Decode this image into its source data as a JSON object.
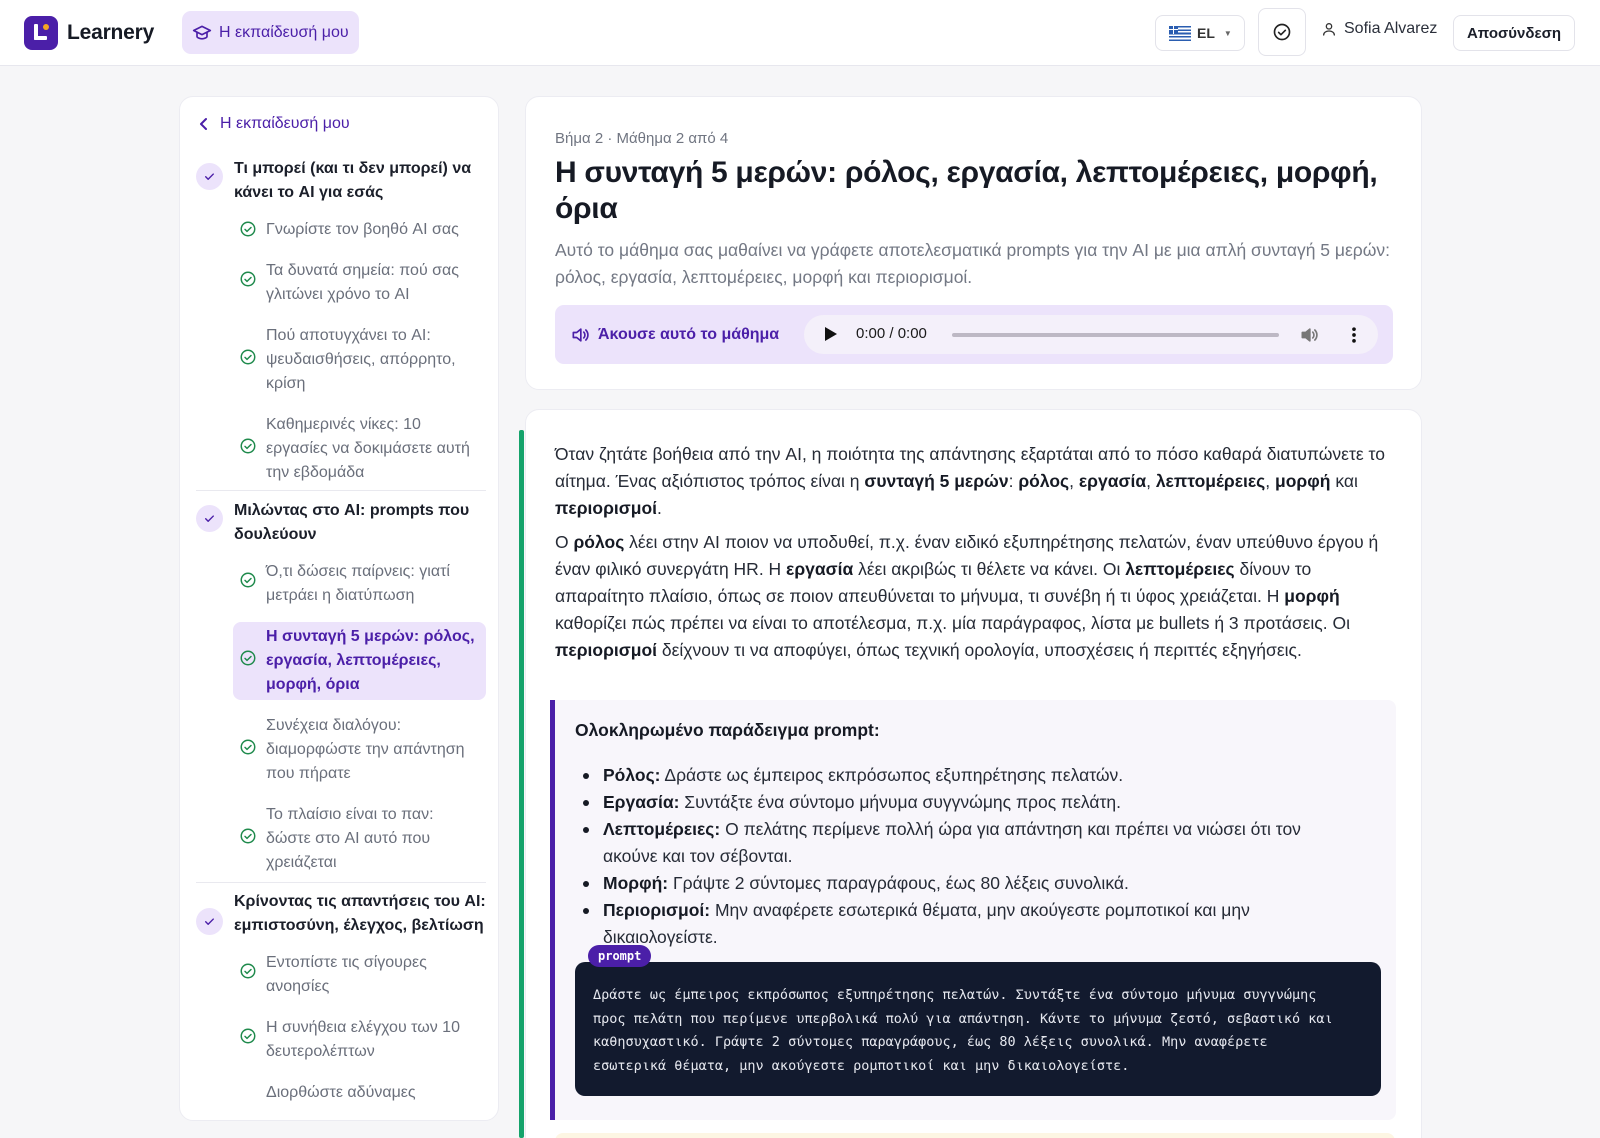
{
  "app": {
    "name": "Learnery"
  },
  "header": {
    "nav_label": "Η εκπαίδευσή μου",
    "language": "EL",
    "user_name": "Sofia Alvarez",
    "logout_label": "Αποσύνδεση"
  },
  "sidebar": {
    "back_label": "Η εκπαίδευσή μου",
    "modules": [
      {
        "title": "Τι μπορεί (και τι δεν μπορεί) να κάνει το AI για εσάς",
        "lessons": [
          "Γνωρίστε τον βοηθό AI σας",
          "Τα δυνατά σημεία: πού σας γλιτώνει χρόνο το AI",
          "Πού αποτυγχάνει το AI: ψευδαισθήσεις, απόρρητο, κρίση",
          "Καθημερινές νίκες: 10 εργασίες να δοκιμάσετε αυτή την εβδομάδα"
        ]
      },
      {
        "title": "Μιλώντας στο AI: prompts που δουλεύουν",
        "lessons": [
          "Ό,τι δώσεις παίρνεις: γιατί μετράει η διατύπωση",
          "Η συνταγή 5 μερών: ρόλος, εργασία, λεπτομέρειες, μορφή, όρια",
          "Συνέχεια διαλόγου: διαμορφώστε την απάντηση που πήρατε",
          "Το πλαίσιο είναι το παν: δώστε στο AI αυτό που χρειάζεται"
        ]
      },
      {
        "title": "Κρίνοντας τις απαντήσεις του AI: εμπιστοσύνη, έλεγχος, βελτίωση",
        "lessons": [
          "Εντοπίστε τις σίγουρες ανοησίες",
          "Η συνήθεια ελέγχου των 10 δευτερολέπτων",
          "Διορθώστε αδύναμες"
        ]
      }
    ]
  },
  "lesson": {
    "breadcrumb": "Βήμα 2 · Μάθημα 2 από 4",
    "title": "Η συνταγή 5 μερών: ρόλος, εργασία, λεπτομέρειες, μορφή, όρια",
    "description": "Αυτό το μάθημα σας μαθαίνει να γράφετε αποτελεσματικά prompts για την AI με μια απλή συνταγή 5 μερών: ρόλος, εργασία, λεπτομέρειες, μορφή και περιορισμοί.",
    "audio_label": "Άκουσε αυτό το μάθημα",
    "audio_time": "0:00 / 0:00",
    "audio_progress": 0
  },
  "body": {
    "p1": {
      "t1": "Όταν ζητάτε βοήθεια από την AI, η ποιότητα της απάντησης εξαρτάται από το πόσο καθαρά διατυπώνετε το αίτημα. Ένας αξιόπιστος τρόπος είναι η ",
      "b1": "συνταγή 5 μερών",
      "t2": ": ",
      "b2": "ρόλος",
      "t3": ", ",
      "b3": "εργασία",
      "t4": ", ",
      "b4": "λεπτομέρειες",
      "t5": ", ",
      "b5": "μορφή",
      "t6": " και ",
      "b6": "περιορισμοί",
      "t7": "."
    },
    "p2": {
      "t1": "Ο ",
      "b1": "ρόλος",
      "t2": " λέει στην AI ποιον να υποδυθεί, π.χ. έναν ειδικό εξυπηρέτησης πελατών, έναν υπεύθυνο έργου ή έναν φιλικό συνεργάτη HR. Η ",
      "b2": "εργασία",
      "t3": " λέει ακριβώς τι θέλετε να κάνει. Οι ",
      "b3": "λεπτομέρειες",
      "t4": " δίνουν το απαραίτητο πλαίσιο, όπως σε ποιον απευθύνεται το μήνυμα, τι συνέβη ή τι ύφος χρειάζεται. Η ",
      "b4": "μορφή",
      "t5": " καθορίζει πώς πρέπει να είναι το αποτέλεσμα, π.χ. μία παράγραφος, λίστα με bullets ή 3 προτάσεις. Οι ",
      "b5": "περιορισμοί",
      "t6": " δείχνουν τι να αποφύγει, όπως τεχνική ορολογία, υποσχέσεις ή περιττές εξηγήσεις."
    },
    "example": {
      "title": "Ολοκληρωμένο παράδειγμα prompt:",
      "items": [
        {
          "label": "Ρόλος:",
          "text": " Δράστε ως έμπειρος εκπρόσωπος εξυπηρέτησης πελατών."
        },
        {
          "label": "Εργασία:",
          "text": " Συντάξτε ένα σύντομο μήνυμα συγγνώμης προς πελάτη."
        },
        {
          "label": "Λεπτομέρειες:",
          "text": " Ο πελάτης περίμενε πολλή ώρα για απάντηση και πρέπει να νιώσει ότι τον ακούνε και τον σέβονται."
        },
        {
          "label": "Μορφή:",
          "text": " Γράψτε 2 σύντομες παραγράφους, έως 80 λέξεις συνολικά."
        },
        {
          "label": "Περιορισμοί:",
          "text": " Μην αναφέρετε εσωτερικά θέματα, μην ακούγεστε ρομποτικοί και μην δικαιολογείστε."
        }
      ],
      "code_tag": "prompt",
      "code": "Δράστε ως έμπειρος εκπρόσωπος εξυπηρέτησης πελατών. Συντάξτε ένα σύντομο μήνυμα συγγνώμης\nπρος πελάτη που περίμενε υπερβολικά πολύ για απάντηση. Κάντε το μήνυμα ζεστό, σεβαστικό και\nκαθησυχαστικό. Γράψτε 2 σύντομες παραγράφους, έως 80 λέξεις συνολικά. Μην αναφέρετε\nεσωτερικά θέματα, μην ακούγεστε ρομποτικοί και μην δικαιολογείστε."
    }
  },
  "colors": {
    "brand": "#4b1fa8",
    "brand_tint": "#ece3fb",
    "accent_green": "#15a36b",
    "check_green": "#1f8a4c",
    "code_bg": "#121a2e"
  }
}
